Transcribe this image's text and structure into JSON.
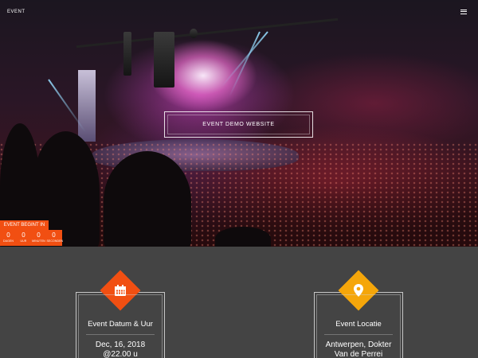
{
  "header": {
    "brand": "EVENT",
    "menu_icon": "hamburger-menu-icon"
  },
  "hero": {
    "title": "EVENT DEMO WEBSITE"
  },
  "countdown": {
    "label": "EVENT BEGINT IN",
    "units": [
      {
        "value": "0",
        "label": "DAGEN"
      },
      {
        "value": "0",
        "label": "UUR"
      },
      {
        "value": "0",
        "label": "MINUTEN"
      },
      {
        "value": "0",
        "label": "SECONDEN"
      }
    ],
    "accent": "#f14f12"
  },
  "cards": [
    {
      "title": "Event Datum & Uur",
      "icon": "calendar-icon",
      "lines": [
        "Dec, 16, 2018",
        "@22.00 u"
      ],
      "accent": "#f14f12"
    },
    {
      "title": "Event Locatie",
      "icon": "map-pin-icon",
      "lines": [
        "Antwerpen, Dokter",
        "Van de Perrei"
      ],
      "accent": "#f5a60a"
    }
  ]
}
